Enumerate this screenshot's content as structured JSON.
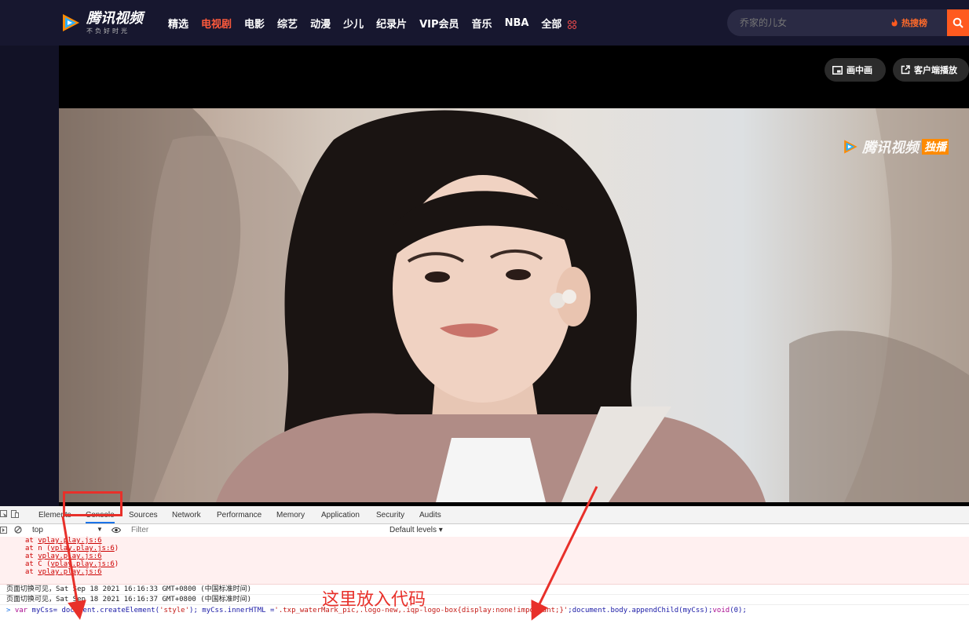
{
  "site": {
    "logo": {
      "name": "腾讯视频",
      "tagline": "不负好时光"
    },
    "nav": [
      {
        "label": "精选",
        "active": false
      },
      {
        "label": "电视剧",
        "active": true
      },
      {
        "label": "电影",
        "active": false
      },
      {
        "label": "综艺",
        "active": false
      },
      {
        "label": "动漫",
        "active": false
      },
      {
        "label": "少儿",
        "active": false
      },
      {
        "label": "纪录片",
        "active": false
      },
      {
        "label": "VIP会员",
        "active": false
      },
      {
        "label": "音乐",
        "active": false
      },
      {
        "label": "NBA",
        "active": false
      },
      {
        "label": "全部",
        "active": false
      }
    ],
    "search": {
      "placeholder": "乔家的儿女",
      "hot_label": "热搜榜"
    },
    "accent": "#ff5a3c"
  },
  "player": {
    "pip_label": "画中画",
    "client_label": "客户端播放",
    "watermark": {
      "text": "腾讯视频",
      "badge": "独播"
    }
  },
  "devtools": {
    "tabs": [
      "Elements",
      "Console",
      "Sources",
      "Network",
      "Performance",
      "Memory",
      "Application",
      "Security",
      "Audits"
    ],
    "active_tab": "Console",
    "context": "top",
    "filter_placeholder": "Filter",
    "levels": "Default levels ▾",
    "error_lines": [
      {
        "prefix": "at ",
        "link": "vplay.play.js:6",
        "suffix": ""
      },
      {
        "prefix": "at n (",
        "link": "vplay.play.js:6",
        "suffix": ")"
      },
      {
        "prefix": "at ",
        "link": "vplay.play.js:6",
        "suffix": ""
      },
      {
        "prefix": "at C (",
        "link": "vplay.play.js:6",
        "suffix": ")"
      },
      {
        "prefix": "at ",
        "link": "vplay.play.js:6",
        "suffix": ""
      }
    ],
    "messages": [
      "页面切换可见，Sat Sep 18 2021 16:16:33 GMT+0800 (中国标准时间)",
      "页面切换可见，Sat Sep 18 2021 16:16:37 GMT+0800 (中国标准时间)"
    ],
    "command": {
      "kw": "var",
      "p1": " myCss= document.createElement(",
      "s1": "'style'",
      "p2": "); myCss.innerHTML =",
      "s2": "'.txp_waterMark_pic,.logo-new,.iqp-logo-box{display:none!important;}'",
      "p3": ";document.body.appendChild(myCss);",
      "kw2": "void",
      "p4": "(0);"
    }
  },
  "annotation": {
    "text": "这里放入代码",
    "color": "#e8302a"
  }
}
